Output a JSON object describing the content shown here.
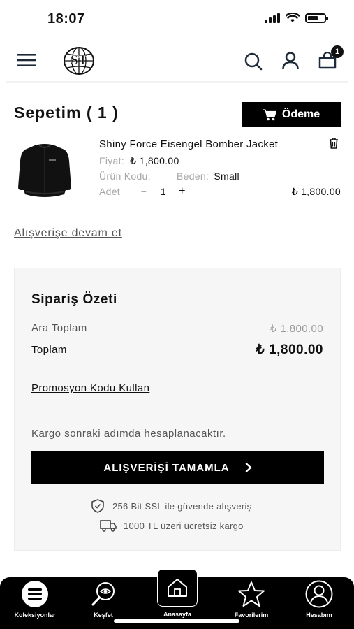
{
  "status_bar": {
    "time": "18:07"
  },
  "header": {
    "logo_text": "ST",
    "cart_count": "1"
  },
  "cart": {
    "title": "Sepetim ( 1 )",
    "checkout_label": "Ödeme",
    "item": {
      "name": "Shiny Force Eisengel Bomber Jacket",
      "price_label": "Fiyat:",
      "price": "₺ 1,800.00",
      "code_label": "Ürün Kodu:",
      "size_label": "Beden:",
      "size": "Small",
      "qty_label": "Adet",
      "minus": "−",
      "qty": "1",
      "plus": "+",
      "total": "₺ 1,800.00"
    },
    "continue_label": "Alışverişe devam et"
  },
  "summary": {
    "title": "Sipariş Özeti",
    "subtotal_label": "Ara Toplam",
    "subtotal": "₺ 1,800.00",
    "total_label": "Toplam",
    "total": "₺ 1,800.00",
    "promo_label": "Promosyon Kodu Kullan",
    "shipping_note": "Kargo sonraki adımda hesaplanacaktır.",
    "complete_label": "ALIŞVERİŞİ TAMAMLA",
    "ssl_text": "256 Bit SSL ile güvende alışveriş",
    "free_shipping_text": "1000 TL üzeri ücretsiz kargo"
  },
  "bottom_nav": {
    "collections": "Koleksiyonlar",
    "explore": "Keşfet",
    "home": "Anasayfa",
    "favorites": "Favorilerim",
    "account": "Hesabım"
  }
}
